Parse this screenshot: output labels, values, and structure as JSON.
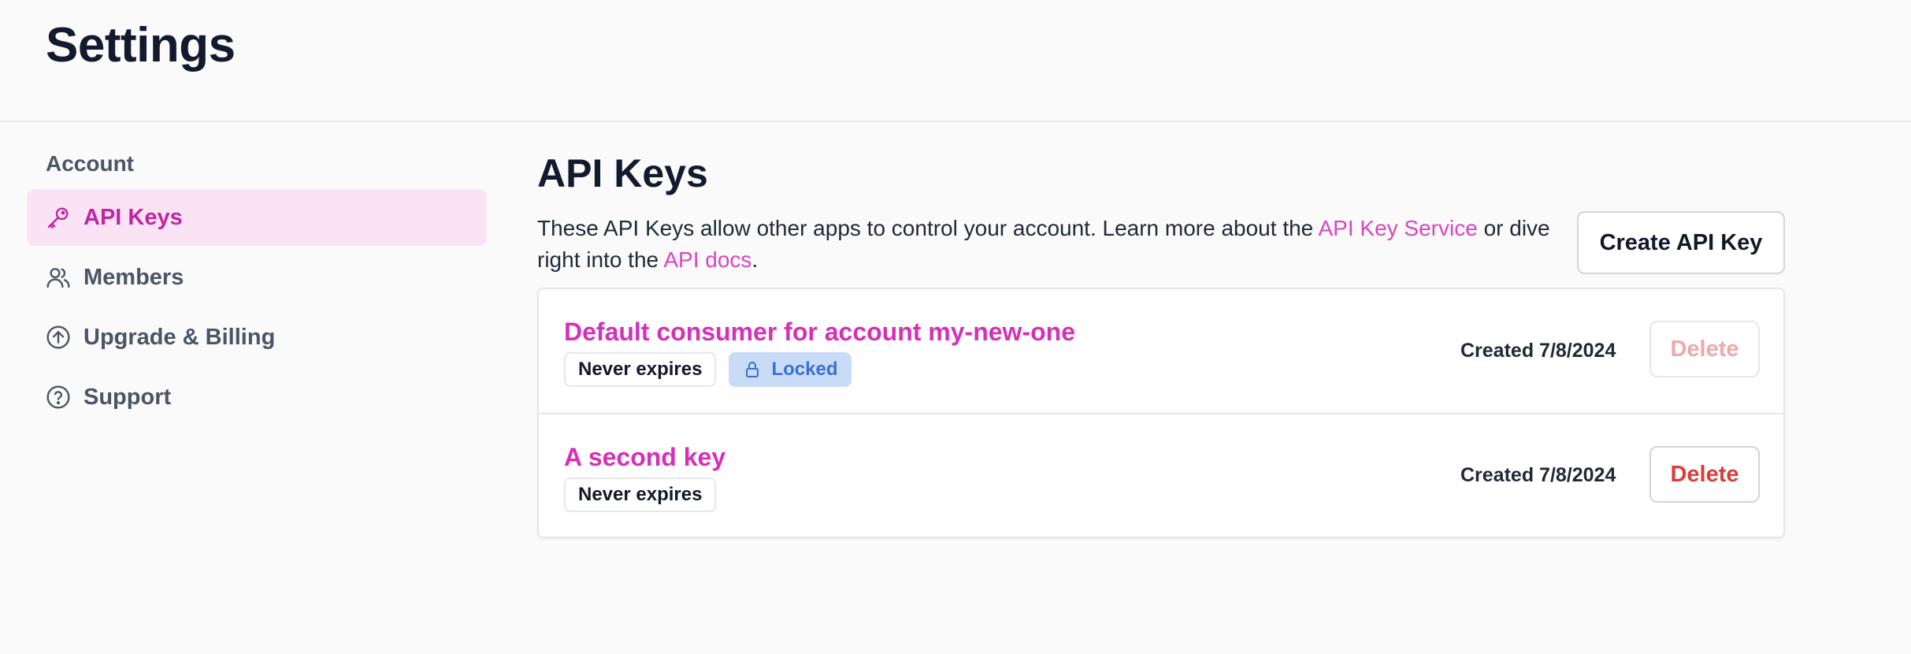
{
  "page": {
    "title": "Settings"
  },
  "sidebar": {
    "section_label": "Account",
    "items": [
      {
        "label": "API Keys",
        "icon": "key-icon",
        "active": true
      },
      {
        "label": "Members",
        "icon": "users-icon",
        "active": false
      },
      {
        "label": "Upgrade & Billing",
        "icon": "arrow-up-circle-icon",
        "active": false
      },
      {
        "label": "Support",
        "icon": "help-circle-icon",
        "active": false
      }
    ]
  },
  "main": {
    "title": "API Keys",
    "description": {
      "part1": "These API Keys allow other apps to control your account. Learn more about the ",
      "link1": "API Key Service",
      "part2": " or dive right into the ",
      "link2": "API docs",
      "part3": "."
    },
    "create_button": "Create API Key",
    "keys": [
      {
        "name": "Default consumer for account my-new-one",
        "expires_badge": "Never expires",
        "locked_badge": "Locked",
        "created": "Created 7/8/2024",
        "delete_label": "Delete",
        "delete_disabled": true
      },
      {
        "name": "A second key",
        "expires_badge": "Never expires",
        "created": "Created 7/8/2024",
        "delete_label": "Delete",
        "delete_disabled": false
      }
    ]
  },
  "colors": {
    "accent": "#d62fb8",
    "active_bg": "#fbe3f6",
    "locked_bg": "#c8dcf7",
    "danger": "#dc3b3b"
  }
}
